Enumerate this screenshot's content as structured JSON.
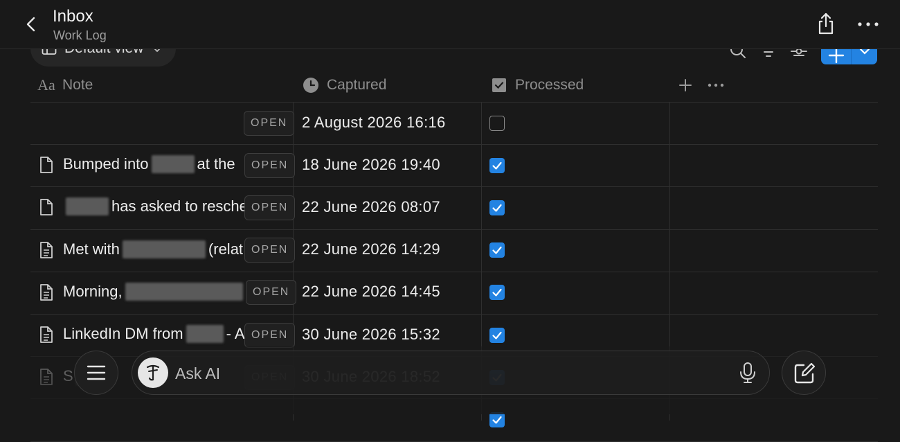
{
  "header": {
    "title": "Inbox",
    "subtitle": "Work Log"
  },
  "toolbar": {
    "view_label": "Default view"
  },
  "columns": {
    "note": "Note",
    "captured": "Captured",
    "processed": "Processed"
  },
  "open_label": "OPEN",
  "rows": [
    {
      "note_parts": [],
      "captured": "2 August 2026 16:16",
      "processed": false
    },
    {
      "note_parts": [
        "Bumped into",
        "#R62",
        "at the"
      ],
      "captured": "18 June 2026 19:40",
      "processed": true
    },
    {
      "note_parts": [
        "#R62",
        "has asked to resche"
      ],
      "captured": "22 June 2026 08:07",
      "processed": true
    },
    {
      "note_parts": [
        "Met with",
        "#R120",
        "(relat"
      ],
      "captured": "22 June 2026 14:29",
      "processed": true
    },
    {
      "note_parts": [
        "Morning,",
        "#R170"
      ],
      "captured": "22 June 2026 14:45",
      "processed": true
    },
    {
      "note_parts": [
        "LinkedIn DM from",
        "#R54",
        "- A"
      ],
      "captured": "30 June 2026 15:32",
      "processed": true
    },
    {
      "note_parts": [
        "S",
        "#R20",
        "ed"
      ],
      "captured": "30 June 2026 18:52",
      "processed": true
    },
    {
      "note_parts": [],
      "captured": "",
      "processed": true
    }
  ],
  "bottom_bar": {
    "ask_ai_label": "Ask AI"
  },
  "colors": {
    "accent": "#2383e2",
    "background": "#191919"
  }
}
